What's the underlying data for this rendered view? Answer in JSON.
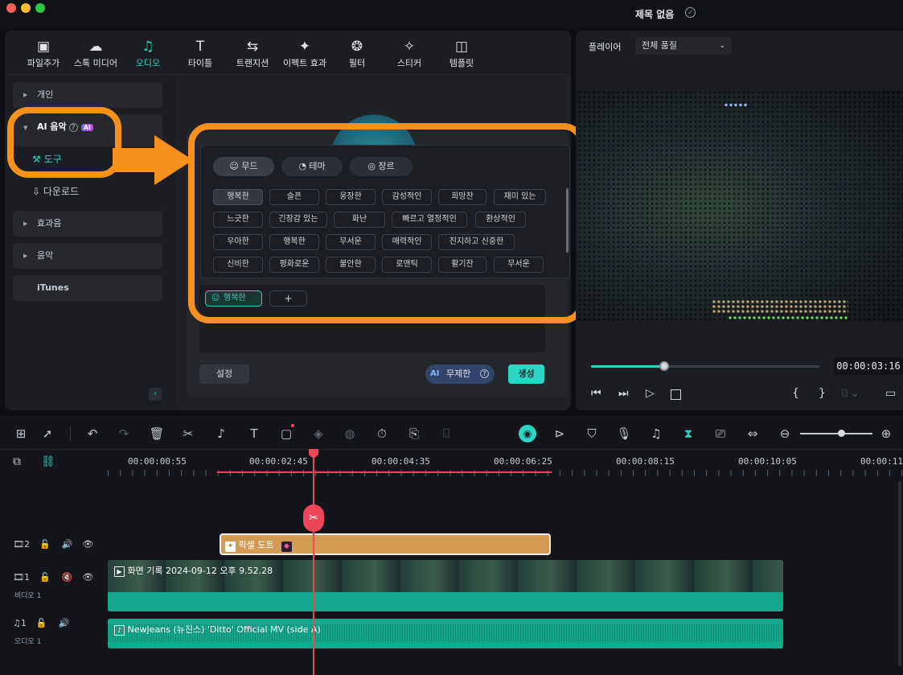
{
  "window": {
    "title": "제목 없음"
  },
  "toolbar": {
    "items": [
      {
        "label": "파일추가",
        "icon": "media-icon"
      },
      {
        "label": "스톡 미디어",
        "icon": "stock-icon"
      },
      {
        "label": "오디오",
        "icon": "music-note-icon"
      },
      {
        "label": "타이틀",
        "icon": "text-icon"
      },
      {
        "label": "트랜지션",
        "icon": "transition-icon"
      },
      {
        "label": "이펙트 효과",
        "icon": "effects-icon"
      },
      {
        "label": "필터",
        "icon": "filter-icon"
      },
      {
        "label": "스티커",
        "icon": "sticker-icon"
      },
      {
        "label": "템플릿",
        "icon": "template-icon"
      }
    ]
  },
  "sidebar": {
    "personal": "개인",
    "ai_music": "AI 음악",
    "ai_badge": "AI",
    "tools": "도구",
    "download": "다운로드",
    "sfx": "효과음",
    "music": "음악",
    "itunes": "iTunes"
  },
  "ai_panel": {
    "tabs": [
      "무드",
      "테마",
      "장르"
    ],
    "mood_rows": [
      [
        "행복한",
        "슬픈",
        "웅장한",
        "감성적인",
        "희망찬",
        "재미 있는"
      ],
      [
        "느긋한",
        "긴장감 있는",
        "화난",
        "빠르고 열정적인",
        "환상적인"
      ],
      [
        "우아한",
        "행복한",
        "무서운",
        "매력적인",
        "진지하고 신중한"
      ],
      [
        "신비한",
        "평화로운",
        "불안한",
        "로맨틱",
        "활기찬",
        "무서운"
      ]
    ],
    "selected_tag": "행복한",
    "add_label": "+",
    "settings_label": "설정",
    "unlimited_label": "무제한",
    "ai_label": "AI",
    "generate_label": "생성"
  },
  "player": {
    "label": "플레이어",
    "quality": "전체 품질",
    "timecode": "00:00:03:16",
    "progress": 0.32
  },
  "timeline": {
    "ruler": [
      "00:00:00:55",
      "00:00:02:45",
      "00:00:04:35",
      "00:00:06:25",
      "00:00:08:15",
      "00:00:10:05",
      "00:00:11:"
    ],
    "tracks": {
      "t2_num": "2",
      "t1_num": "1",
      "video1": "비디오 1",
      "a1_num": "1",
      "audio1": "오디오 1"
    },
    "clips": {
      "effect": "픽셀 도트",
      "video": "화면 기록 2024-09-12 오후 9.52.28",
      "audio": "NewJeans (뉴진스) 'Ditto' Official MV (side A)"
    }
  },
  "colors": {
    "accent": "#2fd3c4",
    "highlight": "#f7911d",
    "playhead": "#f0465a",
    "effect_clip": "#d49c53"
  }
}
